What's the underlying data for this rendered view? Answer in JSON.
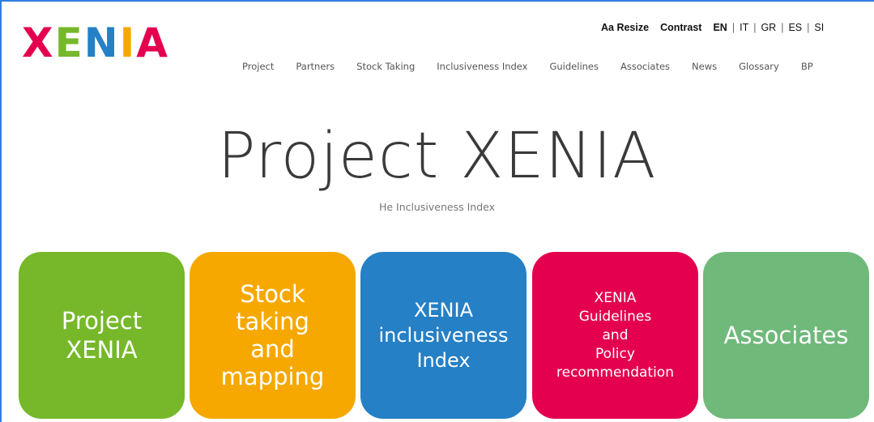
{
  "logo": {
    "letters": [
      "X",
      "E",
      "N",
      "I",
      "A"
    ],
    "colors": [
      "#e4004f",
      "#76b82a",
      "#2580c5",
      "#f6a800",
      "#e4004f"
    ]
  },
  "utility": {
    "resize_label": "Aa Resize",
    "contrast_label": "Contrast",
    "languages": [
      "EN",
      "IT",
      "GR",
      "ES",
      "SI"
    ],
    "active_language": "EN"
  },
  "nav": {
    "items": [
      "Project",
      "Partners",
      "Stock Taking",
      "Inclusiveness Index",
      "Guidelines",
      "Associates",
      "News",
      "Glossary",
      "BP"
    ]
  },
  "hero": {
    "title": "Project XENIA",
    "subtitle": "He Inclusiveness Index"
  },
  "tiles": [
    {
      "label": "Project\nXENIA",
      "color": "#76b82a"
    },
    {
      "label": "Stock\ntaking\nand\nmapping",
      "color": "#f6a800"
    },
    {
      "label": "XENIA\ninclusiveness\nIndex",
      "color": "#2580c5"
    },
    {
      "label": "XENIA\nGuidelines\nand\nPolicy\nrecommendation",
      "color": "#e4004f"
    },
    {
      "label": "Associates",
      "color": "#6fb97a"
    }
  ]
}
